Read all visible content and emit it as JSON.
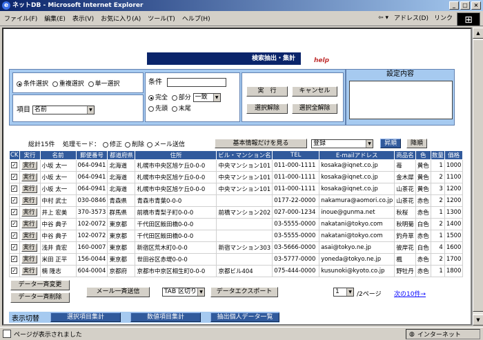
{
  "window": {
    "title": "ネットDB - Microsoft Internet Explorer",
    "buttons": [
      "_",
      "□",
      "×"
    ]
  },
  "menu": {
    "items": [
      "ファイル(F)",
      "編集(E)",
      "表示(V)",
      "お気に入り(A)",
      "ツール(T)",
      "ヘルプ(H)"
    ],
    "address_label": "アドレス(D)",
    "links_label": "リンク"
  },
  "header": {
    "title": "検索抽出・集計",
    "help": "help"
  },
  "condition": {
    "modes": [
      "条件選択",
      "重複選択",
      "単一選択"
    ],
    "mode_selected": 0,
    "item_label": "項目",
    "item_value": "名前",
    "cond_label": "条件",
    "match_opts": [
      "完全",
      "部分",
      "先頭",
      "末尾"
    ],
    "match_selected": 0,
    "match_type": "一致",
    "btn_exec": "実　行",
    "btn_cancel": "キャンセル",
    "btn_sel_clear": "選択解除",
    "btn_sel_all_clear": "選択全解除"
  },
  "settings": {
    "label": "設定内容"
  },
  "toolbar": {
    "count": "総計15件",
    "mode_label": "処理モード：",
    "mode_opts": [
      "修正",
      "削除",
      "メール送信"
    ],
    "btn_basic": "基本情報だけを見る",
    "register_value": "登録",
    "btn_asc": "昇順",
    "btn_desc": "降順"
  },
  "table": {
    "headers": [
      "CK",
      "実行",
      "名前",
      "郵便番号",
      "都道府県",
      "住所",
      "ビル・マンション名",
      "TEL",
      "E-mailアドレス",
      "商品名",
      "色",
      "数量",
      "価格"
    ],
    "exec_label": "実行",
    "rows": [
      {
        "name": "小坂 太一",
        "zip": "064-0941",
        "pref": "北海道",
        "addr": "札幌市中央区旭ケ丘0-0-0",
        "bldg": "中央マンション101",
        "tel": "011-000-1111",
        "email": "kosaka@iqnet.co.jp",
        "product": "苺",
        "color": "黄色",
        "qty": "1",
        "price": "1000"
      },
      {
        "name": "小坂 太一",
        "zip": "064-0941",
        "pref": "北海道",
        "addr": "札幌市中央区旭ケ丘0-0-0",
        "bldg": "中央マンション101",
        "tel": "011-000-1111",
        "email": "kosaka@iqnet.co.jp",
        "product": "金木犀",
        "color": "黄色",
        "qty": "2",
        "price": "1100"
      },
      {
        "name": "小坂 太一",
        "zip": "064-0941",
        "pref": "北海道",
        "addr": "札幌市中央区旭ケ丘0-0-0",
        "bldg": "中央マンション101",
        "tel": "011-000-1111",
        "email": "kosaka@iqnet.co.jp",
        "product": "山茶花",
        "color": "黄色",
        "qty": "3",
        "price": "1200"
      },
      {
        "name": "中村 武士",
        "zip": "030-0846",
        "pref": "青森県",
        "addr": "青森市青葉0-0-0",
        "bldg": "",
        "tel": "0177-22-0000",
        "email": "nakamura@aomori.co.jp",
        "product": "山茶花",
        "color": "赤色",
        "qty": "2",
        "price": "1200"
      },
      {
        "name": "井上 宏美",
        "zip": "370-3573",
        "pref": "群馬県",
        "addr": "前橋市青梨子町0-0-0",
        "bldg": "前橋マンション202",
        "tel": "027-000-1234",
        "email": "inoue@gunma.net",
        "product": "秋桜",
        "color": "赤色",
        "qty": "1",
        "price": "1300"
      },
      {
        "name": "中谷 典子",
        "zip": "102-0072",
        "pref": "東京都",
        "addr": "千代田区飯田橋0-0-0",
        "bldg": "",
        "tel": "03-5555-0000",
        "email": "nakatani@tokyo.com",
        "product": "秋明菊",
        "color": "白色",
        "qty": "2",
        "price": "1400"
      },
      {
        "name": "中谷 典子",
        "zip": "102-0072",
        "pref": "東京都",
        "addr": "千代田区飯田橋0-0-0",
        "bldg": "",
        "tel": "03-5555-0000",
        "email": "nakatani@tokyo.com",
        "product": "釣舟草",
        "color": "赤色",
        "qty": "1",
        "price": "1500"
      },
      {
        "name": "浅井 貴宏",
        "zip": "160-0007",
        "pref": "東京都",
        "addr": "新宿区荒木町0-0-0",
        "bldg": "新宿マンション303",
        "tel": "03-5666-0000",
        "email": "asai@tokyo.ne.jp",
        "product": "彼岸花",
        "color": "白色",
        "qty": "4",
        "price": "1600"
      },
      {
        "name": "米田 正平",
        "zip": "156-0044",
        "pref": "東京都",
        "addr": "世田谷区赤堤0-0-0",
        "bldg": "",
        "tel": "03-5777-0000",
        "email": "yoneda@tokyo.ne.jp",
        "product": "楓",
        "color": "赤色",
        "qty": "2",
        "price": "1700"
      },
      {
        "name": "楠 隆志",
        "zip": "604-0004",
        "pref": "京都府",
        "addr": "京都市中京区相生町0-0-0",
        "bldg": "京都ビル404",
        "tel": "075-444-0000",
        "email": "kusunoki@kyoto.co.jp",
        "product": "野牡丹",
        "color": "赤色",
        "qty": "1",
        "price": "1800"
      }
    ]
  },
  "actions": {
    "btn_bulk_change": "データ一斉変更",
    "btn_bulk_delete": "データ一斉削除",
    "btn_bulk_mail": "メール一斉送信",
    "tab_sep": "TAB 区切り",
    "btn_export": "データエクスポート",
    "page_value": "1",
    "page_total": "/2ページ",
    "next_link": "次の10件→"
  },
  "bottom": {
    "label": "表示切替",
    "btn_sel_sum": "選択項目集計",
    "btn_num_sum": "数値項目集計",
    "btn_extract": "抽出個人データ一覧"
  },
  "status": {
    "text": "ページが表示されました",
    "zone": "インターネット"
  }
}
